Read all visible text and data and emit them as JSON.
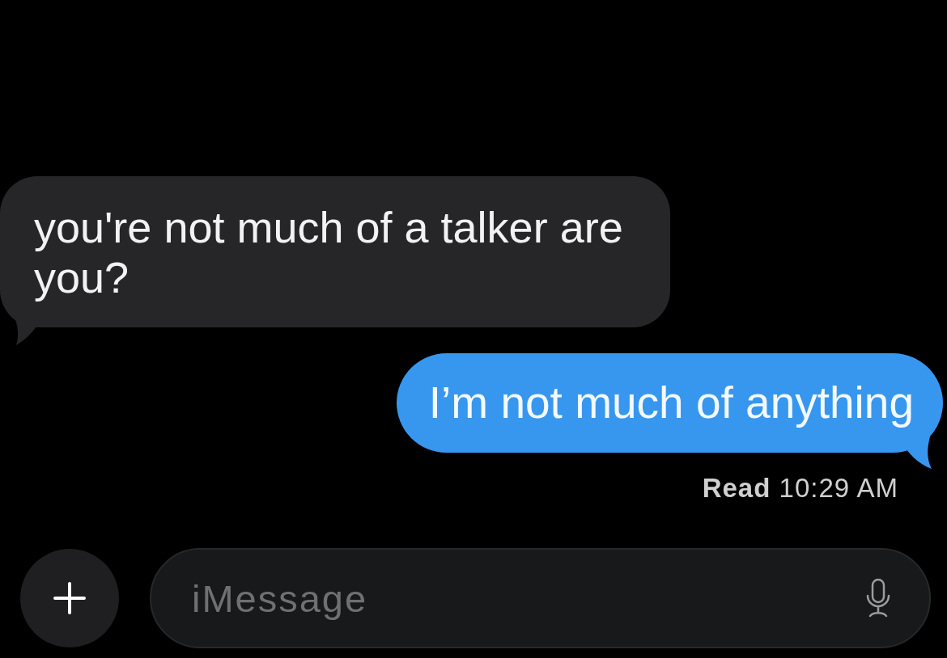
{
  "messages": [
    {
      "kind": "incoming",
      "text": "you're not much of a talker are you?"
    },
    {
      "kind": "outgoing",
      "text": "I’m not much of anything"
    }
  ],
  "receipt": {
    "label": "Read",
    "time": "10:29 AM"
  },
  "composer": {
    "placeholder": "iMessage"
  }
}
